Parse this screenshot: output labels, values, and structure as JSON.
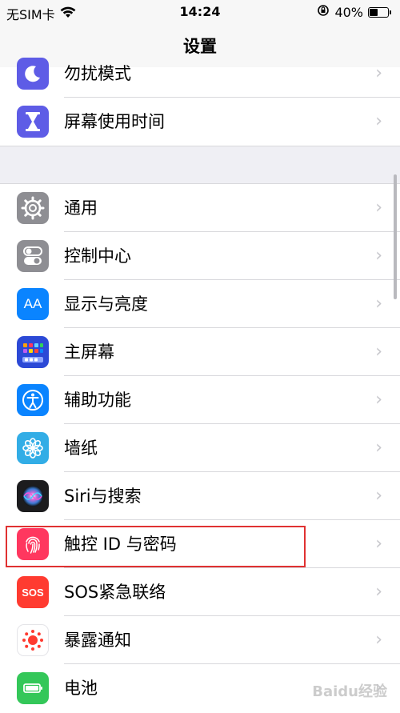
{
  "status_bar": {
    "carrier": "无SIM卡",
    "time": "14:24",
    "battery_percent": "40%",
    "battery_level": 0.4
  },
  "nav": {
    "title": "设置"
  },
  "group1": [
    {
      "label": "勿扰模式",
      "icon": "moon-icon",
      "color": "#5e5ce6"
    },
    {
      "label": "屏幕使用时间",
      "icon": "hourglass-icon",
      "color": "#5e5ce6"
    }
  ],
  "group2": [
    {
      "label": "通用",
      "icon": "gear-icon",
      "color": "#8e8e93"
    },
    {
      "label": "控制中心",
      "icon": "toggles-icon",
      "color": "#8e8e93"
    },
    {
      "label": "显示与亮度",
      "icon": "aa-icon",
      "color": "#0a84ff"
    },
    {
      "label": "主屏幕",
      "icon": "home-grid-icon",
      "color": "#2c49d6"
    },
    {
      "label": "辅助功能",
      "icon": "accessibility-icon",
      "color": "#0a84ff"
    },
    {
      "label": "墙纸",
      "icon": "flower-icon",
      "color": "#32ade6"
    },
    {
      "label": "Siri与搜索",
      "icon": "siri-icon",
      "color": "#1c1c1e"
    },
    {
      "label": "触控 ID 与密码",
      "icon": "fingerprint-icon",
      "color": "#ff375f"
    },
    {
      "label": "SOS紧急联络",
      "icon": "sos-icon",
      "color": "#ff3b30"
    },
    {
      "label": "暴露通知",
      "icon": "exposure-icon",
      "color": "#ffffff"
    },
    {
      "label": "电池",
      "icon": "battery-icon",
      "color": "#34c759"
    }
  ],
  "icon_text": {
    "aa": "AA",
    "sos": "SOS"
  },
  "watermark": "Baidu经验"
}
